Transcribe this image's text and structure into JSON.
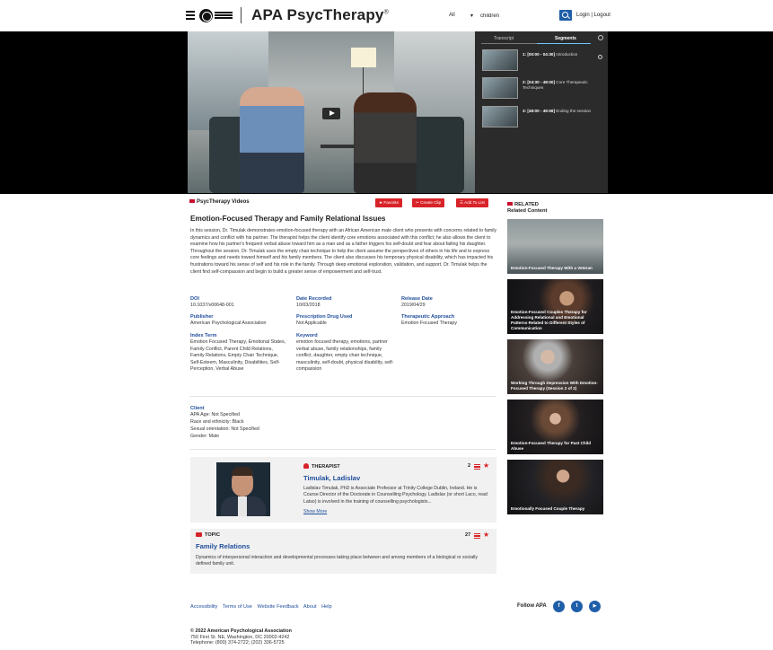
{
  "header": {
    "brand": "APA PsycTherapy",
    "brand_mark": "®",
    "search_scope": "All",
    "search_value": "children",
    "login_links": "Login | Logout"
  },
  "player": {
    "tabs": [
      "Transcript",
      "Segments"
    ],
    "active_tab": "Segments",
    "segments": [
      {
        "time": "1: [00:00 - 04:30]",
        "title": "Introduction"
      },
      {
        "time": "2: [04:30 - 48:00]",
        "title": "Core Therapeutic Techniques"
      },
      {
        "time": "3: [48:00 - 49:59]",
        "title": "Ending the session"
      }
    ]
  },
  "content": {
    "section_label": "PsycTherapy Videos",
    "buttons": {
      "favorite": "Favorite",
      "clip": "Create Clip",
      "add": "Add To List"
    },
    "title": "Emotion-Focused Therapy and Family Relational Issues",
    "description": "In this session, Dr. Timulak demonstrates emotion-focused therapy with an African American male client who presents with concerns related to family dynamics and conflict with his partner. The therapist helps the client identify core emotions associated with this conflict; he also allows the client to examine how his partner's frequent verbal abuse toward him as a man and as a father triggers his self-doubt and fear about failing his daughter. Throughout the session, Dr. Timulak uses the empty chair technique to help the client assume the perspectives of others in his life and to express core feelings and needs toward himself and his family members. The client also discusses his temporary physical disability, which has impacted his frustrations toward his sense of self and his role in the family. Through deep emotional exploration, validation, and support, Dr. Timulak helps the client find self-compassion and begin to build a greater sense of empowerment and self-trust.",
    "meta": {
      "doi_label": "DOI",
      "doi": "10.1037/v00648-001",
      "date_recorded_label": "Date Recorded",
      "date_recorded": "10/03/2018",
      "release_label": "Release Date",
      "release": "2019/04/29",
      "publisher_label": "Publisher",
      "publisher": "American Psychological Association",
      "drug_label": "Prescription Drug Used",
      "drug": "Not Applicable",
      "approach_label": "Therapeutic Approach",
      "approach": "Emotion Focused Therapy",
      "index_label": "Index Term",
      "index": "Emotion Focused Therapy, Emotional States, Family Conflict, Parent Child Relations, Family Relations, Empty Chair Technique, Self-Esteem, Masculinity, Disabilities, Self-Perception, Verbal Abuse",
      "keyword_label": "Keyword",
      "keyword": "emotion focused therapy, emotions, partner verbal abuse, family relationships, family conflict, daughter, empty chair technique, masculinity, self-doubt, physical disability, self-compassion"
    },
    "client": {
      "label": "Client",
      "lines": [
        "APA Age: Not Specified",
        "Race and ethnicity: Black",
        "Sexual orientation: Not Specified",
        "Gender: Male"
      ]
    },
    "therapist": {
      "label": "THERAPIST",
      "name": "Timulak, Ladislav",
      "count": "2",
      "bio": "Ladislav Timulak, PhD is Associate Professor at Trinity College Dublin, Ireland. He is Course Director of the Doctorate in Counselling Psychology. Ladislav (or short Laco, read Latso) is involved in the training of counselling psychologists...",
      "more": "Show More"
    },
    "topic": {
      "label": "TOPIC",
      "name": "Family Relations",
      "count": "27",
      "body": "Dynamics of interpersonal interaction and developmental processes taking place between and among members of a biological or socially defined family unit."
    }
  },
  "related": {
    "label": "RELATED",
    "sublabel": "Related Content",
    "items": [
      "Emotion-Focused Therapy With a Veteran",
      "Emotion-Focused Couples Therapy for Addressing Relational and Emotional Patterns Related to Different Styles of Communication",
      "Working Through Depression With Emotion-Focused Therapy (Session 2 of 2)",
      "Emotion-Focused Therapy for Past Child Abuse",
      "Emotionally Focused Couple Therapy"
    ]
  },
  "footer": {
    "links": [
      "Accessibility",
      "Terms of Use",
      "Website Feedback",
      "About",
      "Help"
    ],
    "follow": "Follow APA",
    "social": [
      "f",
      "t",
      "▶"
    ],
    "copyright": "© 2022 American Psychological Association",
    "address": "750 First St. NE, Washington, DC 20002-4242",
    "phone": "Telephone: (800) 374-2722; (202) 336-5725"
  }
}
